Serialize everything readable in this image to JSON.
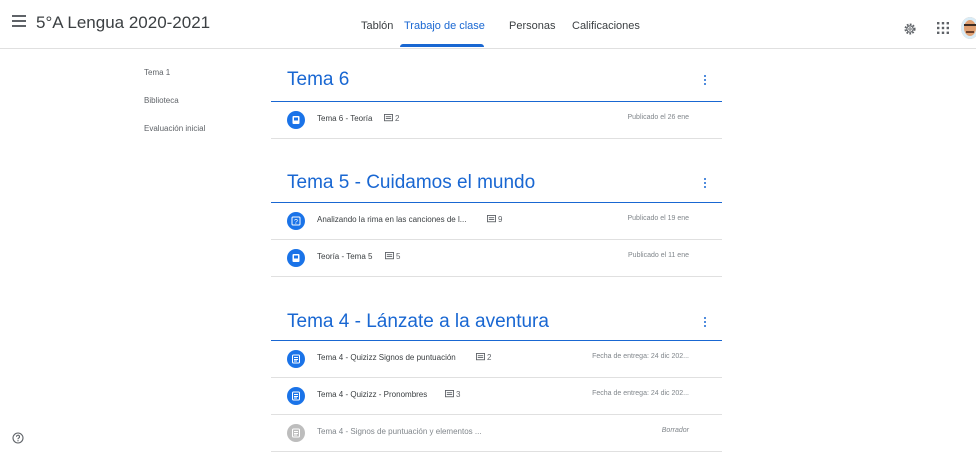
{
  "header": {
    "title": "5°A Lengua 2020-2021",
    "tabs": [
      {
        "label": "Tablón"
      },
      {
        "label": "Trabajo de clase"
      },
      {
        "label": "Personas"
      },
      {
        "label": "Calificaciones"
      }
    ]
  },
  "sidebar": {
    "items": [
      {
        "label": "Tema 1"
      },
      {
        "label": "Biblioteca"
      },
      {
        "label": "Evaluación inicial"
      }
    ]
  },
  "topics": [
    {
      "title": "Tema 6",
      "items": [
        {
          "title": "Tema 6 - Teoría",
          "comments": "2",
          "status": "Publicado el 26 ene",
          "icon": "material-icon"
        }
      ]
    },
    {
      "title": "Tema 5 - Cuidamos el mundo",
      "items": [
        {
          "title": "Analizando la rima en las canciones de l...",
          "comments": "9",
          "status": "Publicado el 19 ene",
          "icon": "question-icon"
        },
        {
          "title": "Teoría - Tema 5",
          "comments": "5",
          "status": "Publicado el 11 ene",
          "icon": "material-icon"
        }
      ]
    },
    {
      "title": "Tema 4 - Lánzate a la aventura",
      "items": [
        {
          "title": "Tema 4 - Quizizz Signos de puntuación",
          "comments": "2",
          "status": "Fecha de entrega: 24 dic 202...",
          "icon": "assignment-icon"
        },
        {
          "title": "Tema 4 - Quizizz - Pronombres",
          "comments": "3",
          "status": "Fecha de entrega: 24 dic 202...",
          "icon": "assignment-icon"
        },
        {
          "title": "Tema 4 - Signos de puntuación y elementos ...",
          "comments": "",
          "status": "Borrador",
          "icon": "assignment-icon"
        }
      ]
    }
  ],
  "colors": {
    "accent": "#1967d2",
    "icon_blue": "#1a73e8",
    "draft_gray": "#bdbdbd"
  }
}
